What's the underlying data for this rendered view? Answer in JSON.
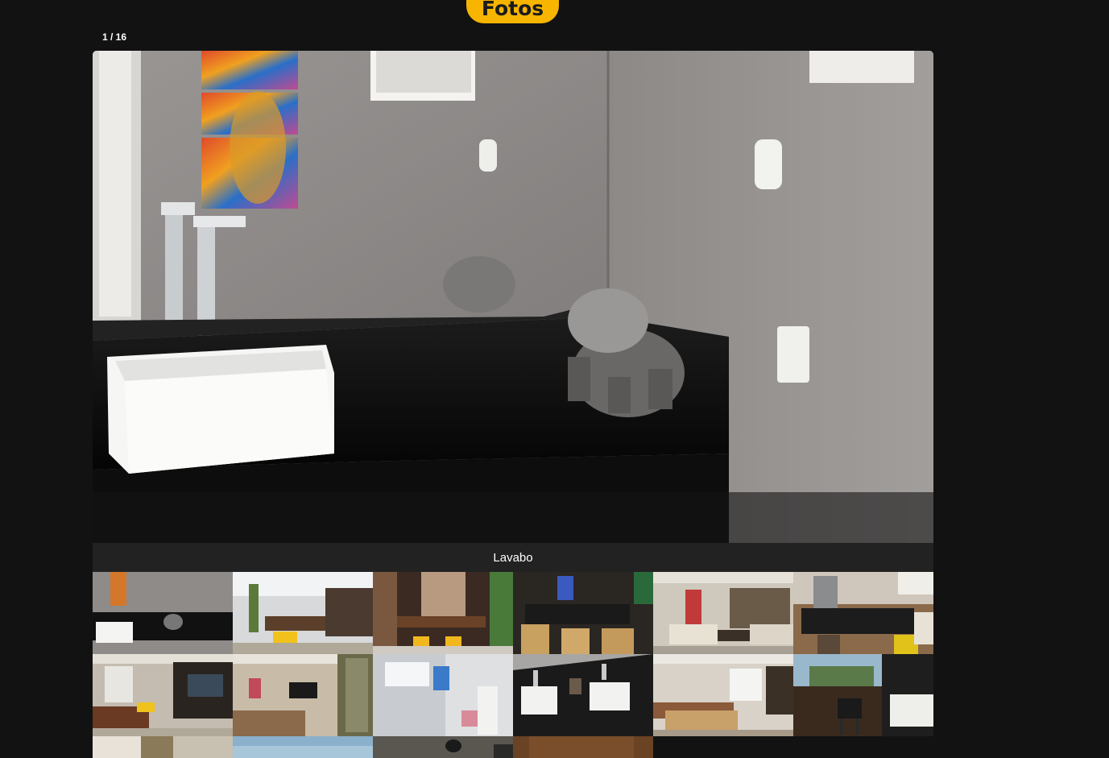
{
  "header": {
    "title": "Fotos"
  },
  "gallery": {
    "counter": "1 / 16",
    "current_caption": "Lavabo",
    "main_photo": "bathroom-sink-photo"
  },
  "thumbnails": [
    {
      "name": "lavabo",
      "scene": "bathroom vanity"
    },
    {
      "name": "patio",
      "scene": "outdoor patio with table"
    },
    {
      "name": "dining-deck",
      "scene": "dining table by wood wall"
    },
    {
      "name": "dining-room",
      "scene": "dining room with yellow chairs"
    },
    {
      "name": "living-room",
      "scene": "living room with sofas"
    },
    {
      "name": "kitchen",
      "scene": "kitchen island"
    },
    {
      "name": "family-room",
      "scene": "family room with tv"
    },
    {
      "name": "bedroom-tv",
      "scene": "bedroom with tv"
    },
    {
      "name": "bathroom-shower",
      "scene": "bathroom shower"
    },
    {
      "name": "double-sink",
      "scene": "double sink counter"
    },
    {
      "name": "master-bedroom",
      "scene": "master bedroom"
    },
    {
      "name": "barbecue-terrace",
      "scene": "terrace with barbecue"
    },
    {
      "name": "exterior",
      "scene": "exterior view"
    },
    {
      "name": "sky-view",
      "scene": "outdoor sky view"
    },
    {
      "name": "hallway",
      "scene": "hallway"
    },
    {
      "name": "wood-room",
      "scene": "wood interior"
    }
  ],
  "colors": {
    "accent": "#f7b500",
    "background": "#121212",
    "caption_bar": "#222222"
  }
}
